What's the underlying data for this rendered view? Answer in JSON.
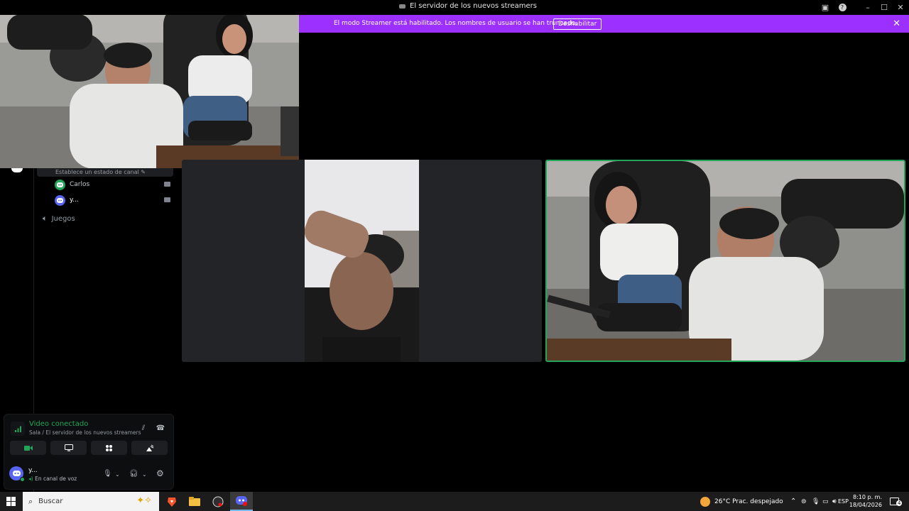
{
  "window": {
    "title": "El servidor de los nuevos streamers"
  },
  "banner": {
    "message": "El modo Streamer está habilitado. Los nombres de usuario se han truncado.",
    "button": "Deshabilitar"
  },
  "sidebar": {
    "status_placeholder": "Establece un estado de canal",
    "members": [
      {
        "name": "Carlos",
        "avatar_color": "#23a55a"
      },
      {
        "name": "y...",
        "avatar_color": "#5865f2"
      }
    ],
    "voice_channel": "Juegos"
  },
  "voice_panel": {
    "title": "Video conectado",
    "subtitle": "Sala / El servidor de los nuevos streamers",
    "user_name": "y...",
    "user_state": "En canal de voz"
  },
  "taskbar": {
    "search_placeholder": "Buscar",
    "weather": "26°C  Prac. despejado",
    "language": "ESP",
    "time": "8:10 p. m.",
    "date": "18/04/2026",
    "notification_count": "4"
  },
  "colors": {
    "accent_green": "#23a55a",
    "banner_purple": "#9b30ff",
    "blurple": "#5865f2"
  }
}
